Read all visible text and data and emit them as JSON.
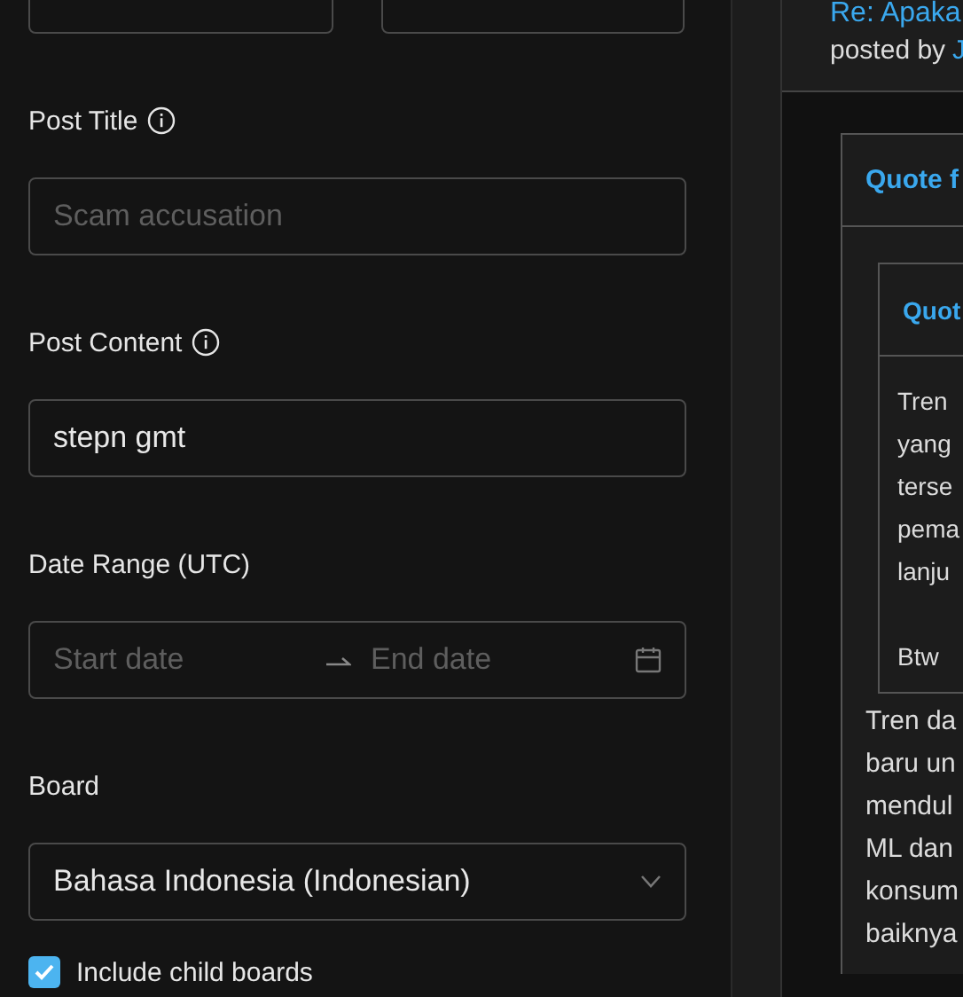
{
  "post_title": {
    "label": "Post Title",
    "placeholder": "Scam accusation"
  },
  "post_content": {
    "label": "Post Content",
    "value": "stepn gmt"
  },
  "date_range": {
    "label": "Date Range (UTC)",
    "start_placeholder": "Start date",
    "end_placeholder": "End date"
  },
  "board": {
    "label": "Board",
    "value": "Bahasa Indonesia (Indonesian)"
  },
  "include_child_boards": {
    "label": "Include child boards",
    "checked": true
  },
  "post": {
    "title": "Re: Apaka",
    "posted_by": "posted by",
    "author": "J",
    "quote": {
      "header": "Quote f",
      "nested_quote": {
        "header": "Quot",
        "paragraphs": [
          [
            "Tren",
            "yang",
            "terse",
            "pema",
            "lanju"
          ],
          [
            "Btw"
          ]
        ]
      },
      "lines": [
        "Tren da",
        "baru un",
        "mendul",
        "ML dan",
        "konsum",
        "baiknya"
      ]
    }
  }
}
